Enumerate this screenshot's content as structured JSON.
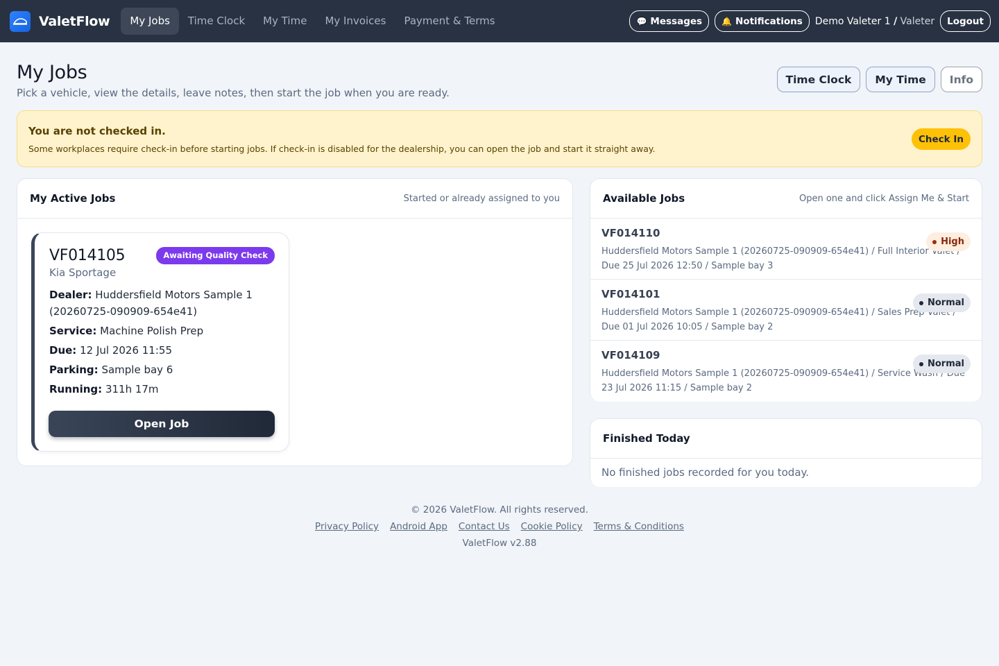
{
  "nav": {
    "brand": "ValetFlow",
    "links": [
      "My Jobs",
      "Time Clock",
      "My Time",
      "My Invoices",
      "Payment & Terms"
    ],
    "messages": "Messages",
    "notifications": "Notifications",
    "user_name": "Demo Valeter 1",
    "user_sep": "/",
    "user_role": "Valeter",
    "logout": "Logout"
  },
  "header": {
    "title": "My Jobs",
    "subtitle": "Pick a vehicle, view the details, leave notes, then start the job when you are ready.",
    "buttons": [
      "Time Clock",
      "My Time",
      "Info"
    ]
  },
  "alert": {
    "title": "You are not checked in.",
    "text": "Some workplaces require check-in before starting jobs. If check-in is disabled for the dealership, you can open the job and start it straight away.",
    "button": "Check In"
  },
  "active": {
    "title": "My Active Jobs",
    "hint": "Started or already assigned to you",
    "job": {
      "id": "VF014105",
      "badge": "Awaiting Quality Check",
      "vehicle": "Kia Sportage",
      "dealer_label": "Dealer:",
      "dealer": "Huddersfield Motors Sample 1 (20260725-090909-654e41)",
      "service_label": "Service:",
      "service": "Machine Polish Prep",
      "due_label": "Due:",
      "due": "12 Jul 2026 11:55",
      "parking_label": "Parking:",
      "parking": "Sample bay 6",
      "running_label": "Running:",
      "running": "311h 17m",
      "open": "Open Job"
    }
  },
  "available": {
    "title": "Available Jobs",
    "hint": "Open one and click Assign Me & Start",
    "items": [
      {
        "id": "VF014110",
        "priority": "High",
        "desc": "Huddersfield Motors Sample 1 (20260725-090909-654e41) / Full Interior Valet / Due 25 Jul 2026 12:50 / Sample bay 3"
      },
      {
        "id": "VF014101",
        "priority": "Normal",
        "desc": "Huddersfield Motors Sample 1 (20260725-090909-654e41) / Sales Prep Valet / Due 01 Jul 2026 10:05 / Sample bay 2"
      },
      {
        "id": "VF014109",
        "priority": "Normal",
        "desc": "Huddersfield Motors Sample 1 (20260725-090909-654e41) / Service Wash / Due 23 Jul 2026 11:15 / Sample bay 2"
      }
    ]
  },
  "finished": {
    "title": "Finished Today",
    "empty": "No finished jobs recorded for you today."
  },
  "footer": {
    "copyright": "© 2026 ValetFlow. All rights reserved.",
    "links": [
      "Privacy Policy",
      "Android App",
      "Contact Us",
      "Cookie Policy",
      "Terms & Conditions"
    ],
    "version": "ValetFlow v2.88"
  },
  "colors": {
    "nav_bg": "#283242",
    "accent": "#2f80ff",
    "badge_purple": "#7c3aed",
    "alert_bg": "#fff3cd",
    "check_in": "#ffc107"
  }
}
